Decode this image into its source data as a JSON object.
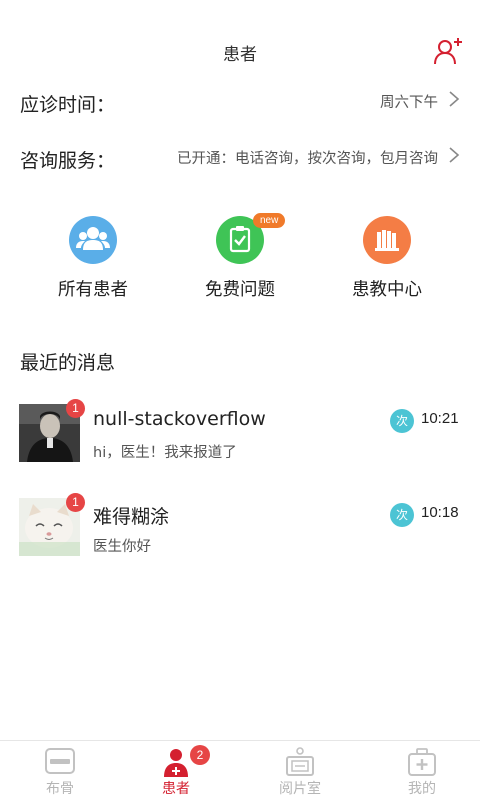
{
  "header": {
    "title": "患者"
  },
  "settings": [
    {
      "label": "应诊时间：",
      "value": "周六下午"
    },
    {
      "label": "咨询服务：",
      "value": "已开通：电话咨询，按次咨询，包月咨询"
    }
  ],
  "quick_actions": [
    {
      "label": "所有患者",
      "icon": "patients-group-icon",
      "color": "#5aaee8"
    },
    {
      "label": "免费问题",
      "icon": "clipboard-check-icon",
      "color": "#3fc456",
      "badge": "new"
    },
    {
      "label": "患教中心",
      "icon": "books-icon",
      "color": "#f47d45"
    }
  ],
  "recent": {
    "title": "最近的消息",
    "messages": [
      {
        "name": "null-stackoverflow",
        "preview": "hi，医生！我来报道了",
        "time": "10:21",
        "type": "次",
        "unread": "1"
      },
      {
        "name": "难得糊涂",
        "preview": "医生你好",
        "time": "10:18",
        "type": "次",
        "unread": "1"
      }
    ]
  },
  "tabbar": {
    "items": [
      {
        "label": "布骨",
        "icon": "buge-logo-icon",
        "active": false
      },
      {
        "label": "患者",
        "icon": "patient-icon",
        "active": true,
        "badge": "2"
      },
      {
        "label": "阅片室",
        "icon": "xray-viewer-icon",
        "active": false
      },
      {
        "label": "我的",
        "icon": "medical-kit-icon",
        "active": false
      }
    ]
  },
  "colors": {
    "accent": "#d42030",
    "badge": "#e64545",
    "type_badge": "#4cc4d4"
  }
}
